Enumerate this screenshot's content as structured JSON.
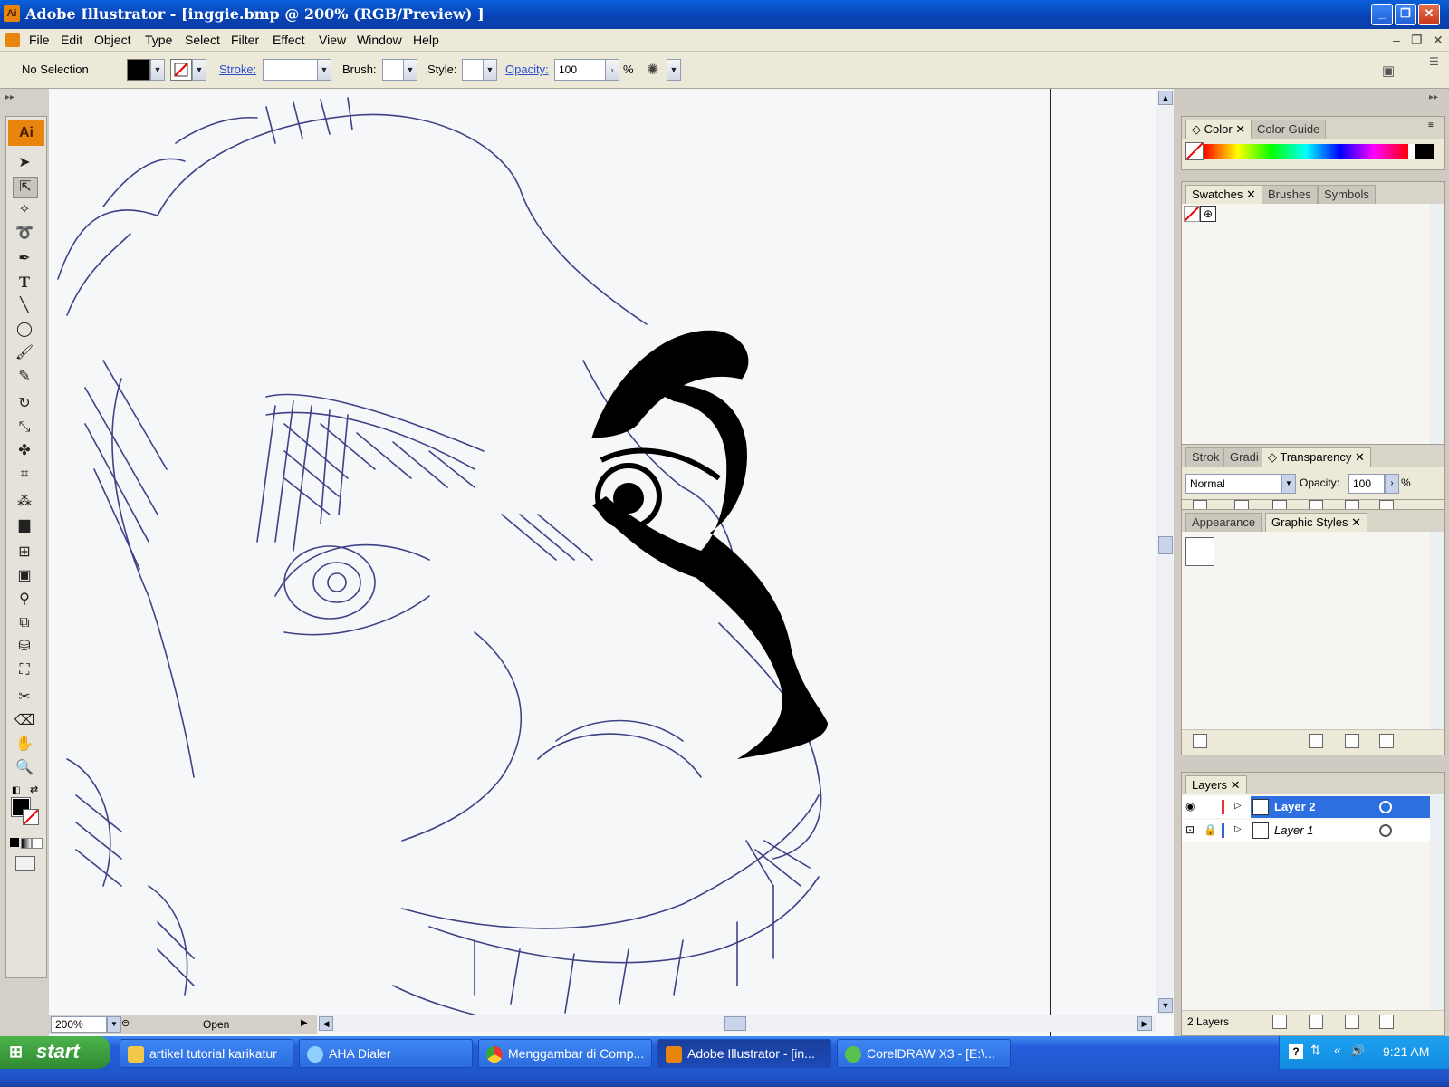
{
  "window": {
    "title": "Adobe Illustrator - [inggie.bmp @ 200% (RGB/Preview) ]",
    "app_icon": "Ai",
    "controls": [
      "_",
      "❐",
      "✕"
    ]
  },
  "menubar": {
    "items": [
      "File",
      "Edit",
      "Object",
      "Type",
      "Select",
      "Filter",
      "Effect",
      "View",
      "Window",
      "Help"
    ],
    "doc_controls": [
      "–",
      "❐",
      "✕"
    ]
  },
  "controlbar": {
    "selection": "No Selection",
    "stroke_label": "Stroke:",
    "brush_label": "Brush:",
    "style_label": "Style:",
    "opacity_label": "Opacity:",
    "opacity_value": "100",
    "percent": "%"
  },
  "tools": {
    "logo": "Ai",
    "items": [
      "selection-tool",
      "direct-selection-tool",
      "magic-wand-tool",
      "lasso-tool",
      "pen-tool",
      "type-tool",
      "line-tool",
      "ellipse-tool",
      "paintbrush-tool",
      "pencil-tool",
      "rotate-tool",
      "scale-tool",
      "warp-tool",
      "free-transform-tool",
      "symbol-sprayer-tool",
      "graph-tool",
      "mesh-tool",
      "gradient-tool",
      "eyedropper-tool",
      "blend-tool",
      "live-paint-tool",
      "live-paint-selection-tool",
      "slice-tool",
      "eraser-tool",
      "hand-tool",
      "zoom-tool"
    ]
  },
  "status": {
    "zoom": "200%",
    "state": "Open"
  },
  "panels": {
    "color": {
      "tabs": [
        "Color",
        "Color Guide"
      ]
    },
    "swatches": {
      "tabs": [
        "Swatches",
        "Brushes",
        "Symbols"
      ]
    },
    "transparency": {
      "tabs": [
        "Strok",
        "Gradi",
        "Transparency"
      ],
      "blend_mode": "Normal",
      "opacity_label": "Opacity:",
      "opacity_value": "100",
      "percent": "%"
    },
    "appearance": {
      "tabs": [
        "Appearance",
        "Graphic Styles"
      ]
    },
    "layers": {
      "tabs": [
        "Layers"
      ],
      "rows": [
        {
          "name": "Layer 2",
          "selected": true
        },
        {
          "name": "Layer 1",
          "selected": false
        }
      ],
      "count": "2 Layers"
    }
  },
  "taskbar": {
    "start": "start",
    "tasks": [
      "artikel tutorial karikatur",
      "AHA Dialer",
      "Menggambar di Comp...",
      "Adobe Illustrator - [in...",
      "CorelDRAW X3 - [E:\\..."
    ],
    "clock": "9:21 AM"
  },
  "colors": {
    "title_blue": "#0a4fc8",
    "ink_blue": "#2c2f7a",
    "selected_layer": "#2d6ee0",
    "start_green": "#3a9c3a"
  }
}
